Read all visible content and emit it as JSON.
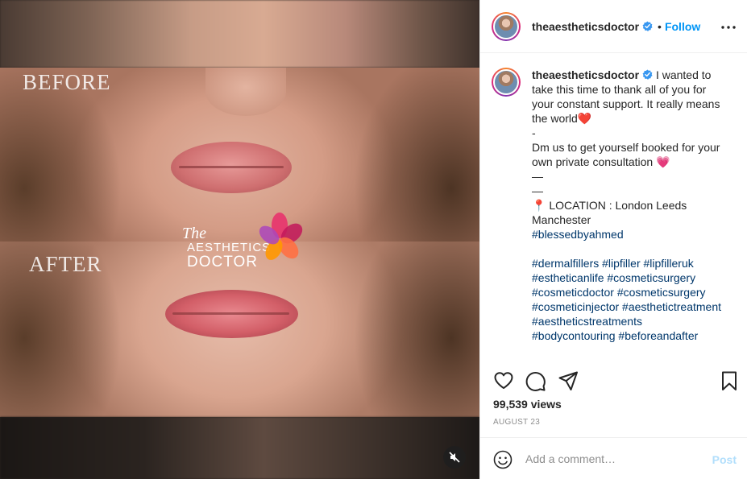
{
  "media": {
    "label_before": "BEFORE",
    "label_after": "AFTER",
    "logo": {
      "the": "The",
      "aesthetics": "AESTHETICS",
      "doctor": "DOCTOR"
    },
    "mute_icon": "speaker-muted-icon"
  },
  "header": {
    "username": "theaestheticsdoctor",
    "separator": "•",
    "follow_label": "Follow",
    "more_icon": "more-horizontal-icon"
  },
  "caption": {
    "username": "theaestheticsdoctor",
    "lines": [
      "I wanted to take this time to thank all of you for your constant support. It really means the world❤️",
      "-",
      "Dm us to get yourself booked for your own private consultation 💗",
      "—",
      "—",
      "📍 LOCATION : London Leeds Manchester"
    ],
    "hashtag_1": "#blessedbyahmed",
    "hashtags_block": "#dermalfillers #lipfiller #lipfilleruk #estheticanlife #cosmeticsurgery #cosmeticdoctor #cosmeticsurgery #cosmeticinjector #aesthetictreatment #aestheticstreatments #bodycontouring #beforeandafter"
  },
  "footer": {
    "views": "99,539 views",
    "date": "AUGUST 23",
    "comment_placeholder": "Add a comment…",
    "post_label": "Post"
  },
  "colors": {
    "follow_blue": "#0095f6",
    "hashtag_blue": "#00376b",
    "post_disabled": "#b2dffc",
    "muted_gray": "#8e8e8e"
  }
}
